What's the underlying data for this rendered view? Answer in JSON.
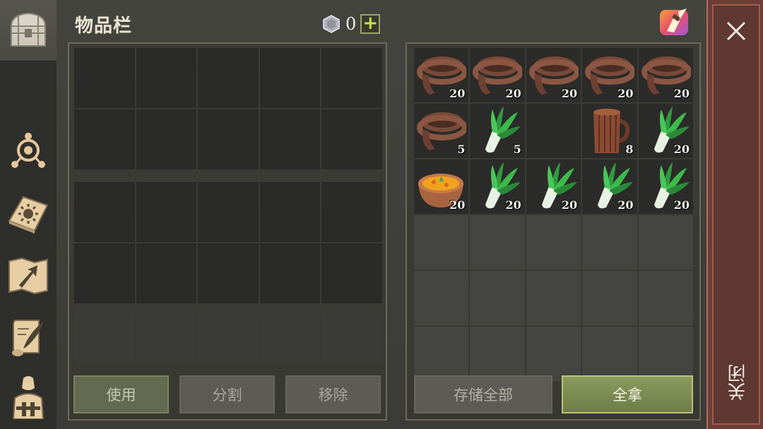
{
  "header": {
    "title": "物品栏",
    "currency_count": "0",
    "add_currency": "+"
  },
  "sidebar": {
    "items": [
      {
        "icon": "chest-icon",
        "active": true
      },
      {
        "icon": "crafting-icon"
      },
      {
        "icon": "sun-book-icon"
      },
      {
        "icon": "map-arrow-icon"
      },
      {
        "icon": "scroll-quill-icon"
      },
      {
        "icon": "character-icon"
      }
    ]
  },
  "player_inventory": {
    "rows": 6,
    "cols": 5,
    "dark_rows": 4,
    "dim_rows": 1
  },
  "container_inventory": {
    "rows": 6,
    "cols": 5,
    "items": [
      {
        "type": "leather-strap",
        "qty": "20"
      },
      {
        "type": "leather-strap",
        "qty": "20"
      },
      {
        "type": "leather-strap",
        "qty": "20"
      },
      {
        "type": "leather-strap",
        "qty": "20"
      },
      {
        "type": "leather-strap",
        "qty": "20"
      },
      {
        "type": "leather-strap",
        "qty": "5"
      },
      {
        "type": "leek",
        "qty": "5"
      },
      {
        "type": "empty",
        "qty": ""
      },
      {
        "type": "wooden-mug",
        "qty": "8"
      },
      {
        "type": "leek",
        "qty": "20"
      },
      {
        "type": "soup-bowl",
        "qty": "20"
      },
      {
        "type": "leek",
        "qty": "20"
      },
      {
        "type": "leek",
        "qty": "20"
      },
      {
        "type": "leek",
        "qty": "20"
      },
      {
        "type": "leek",
        "qty": "20"
      }
    ]
  },
  "buttons": {
    "use": "使用",
    "split": "分割",
    "remove": "移除",
    "store_all": "存储全部",
    "take_all": "全拿"
  },
  "close": {
    "label": "关闭"
  },
  "colors": {
    "accent_green": "#c6e04a",
    "close_red": "#6b3f38",
    "take_all": "#7b8a4f"
  }
}
